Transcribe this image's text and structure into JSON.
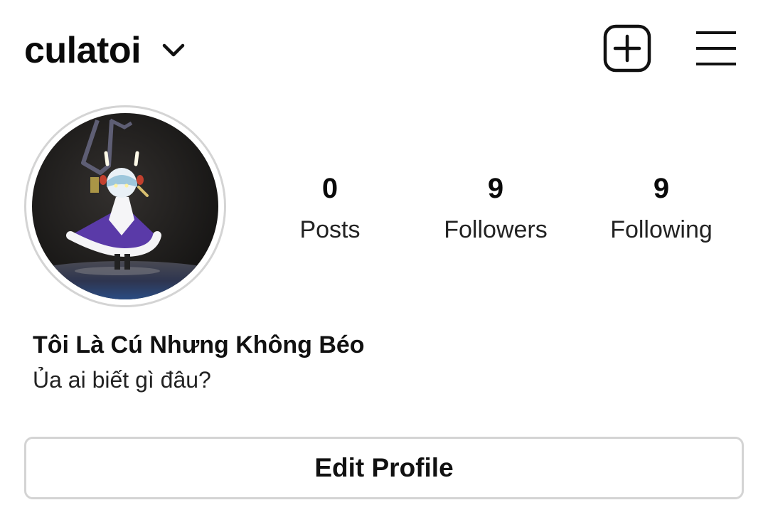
{
  "header": {
    "username": "culatoi",
    "icons": {
      "dropdown": "chevron-down-icon",
      "new_post": "plus-square-icon",
      "menu": "hamburger-menu-icon"
    }
  },
  "profile": {
    "avatar": "avatar-image",
    "display_name": "Tôi Là Cú Nhưng Không Béo",
    "bio": "Ủa ai biết gì đâu?",
    "stats": [
      {
        "count": "0",
        "label": "Posts"
      },
      {
        "count": "9",
        "label": "Followers"
      },
      {
        "count": "9",
        "label": "Following"
      }
    ]
  },
  "actions": {
    "edit_profile": "Edit Profile"
  },
  "colors": {
    "text": "#111111",
    "border": "#d4d4d4",
    "background": "#ffffff"
  }
}
